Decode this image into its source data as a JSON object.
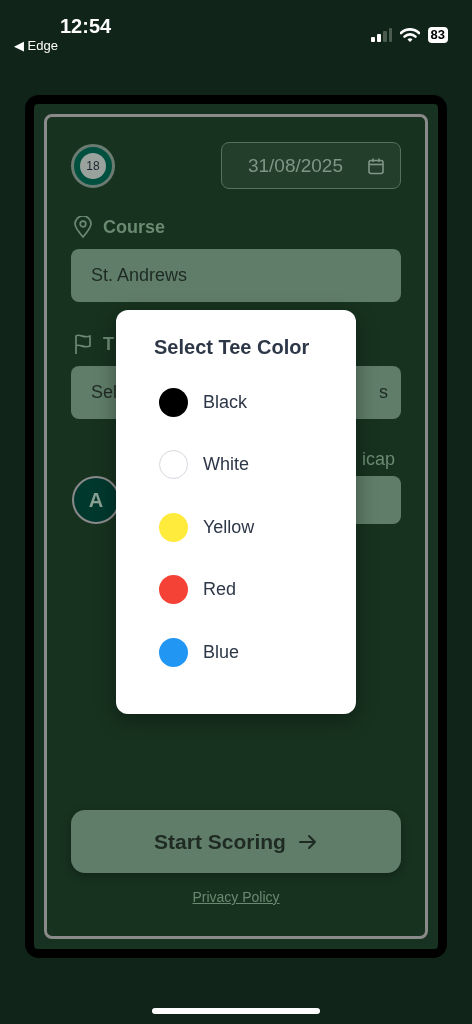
{
  "status_bar": {
    "time": "12:54",
    "back_label": "◀ Edge",
    "battery": "83"
  },
  "header": {
    "badge": "18",
    "date": "31/08/2025"
  },
  "course": {
    "label": "Course",
    "value": "St. Andrews"
  },
  "tee": {
    "label": "T",
    "field_start": "Sel",
    "field_end": "s"
  },
  "player": {
    "avatar": "A",
    "handicap_label": "icap"
  },
  "start_button": "Start Scoring",
  "privacy_link": "Privacy Policy",
  "tee_dialog": {
    "title": "Select Tee Color",
    "options": [
      {
        "label": "Black",
        "color": "#000000"
      },
      {
        "label": "White",
        "color": "#ffffff"
      },
      {
        "label": "Yellow",
        "color": "#ffeb3b"
      },
      {
        "label": "Red",
        "color": "#f44336"
      },
      {
        "label": "Blue",
        "color": "#2196f3"
      }
    ]
  }
}
